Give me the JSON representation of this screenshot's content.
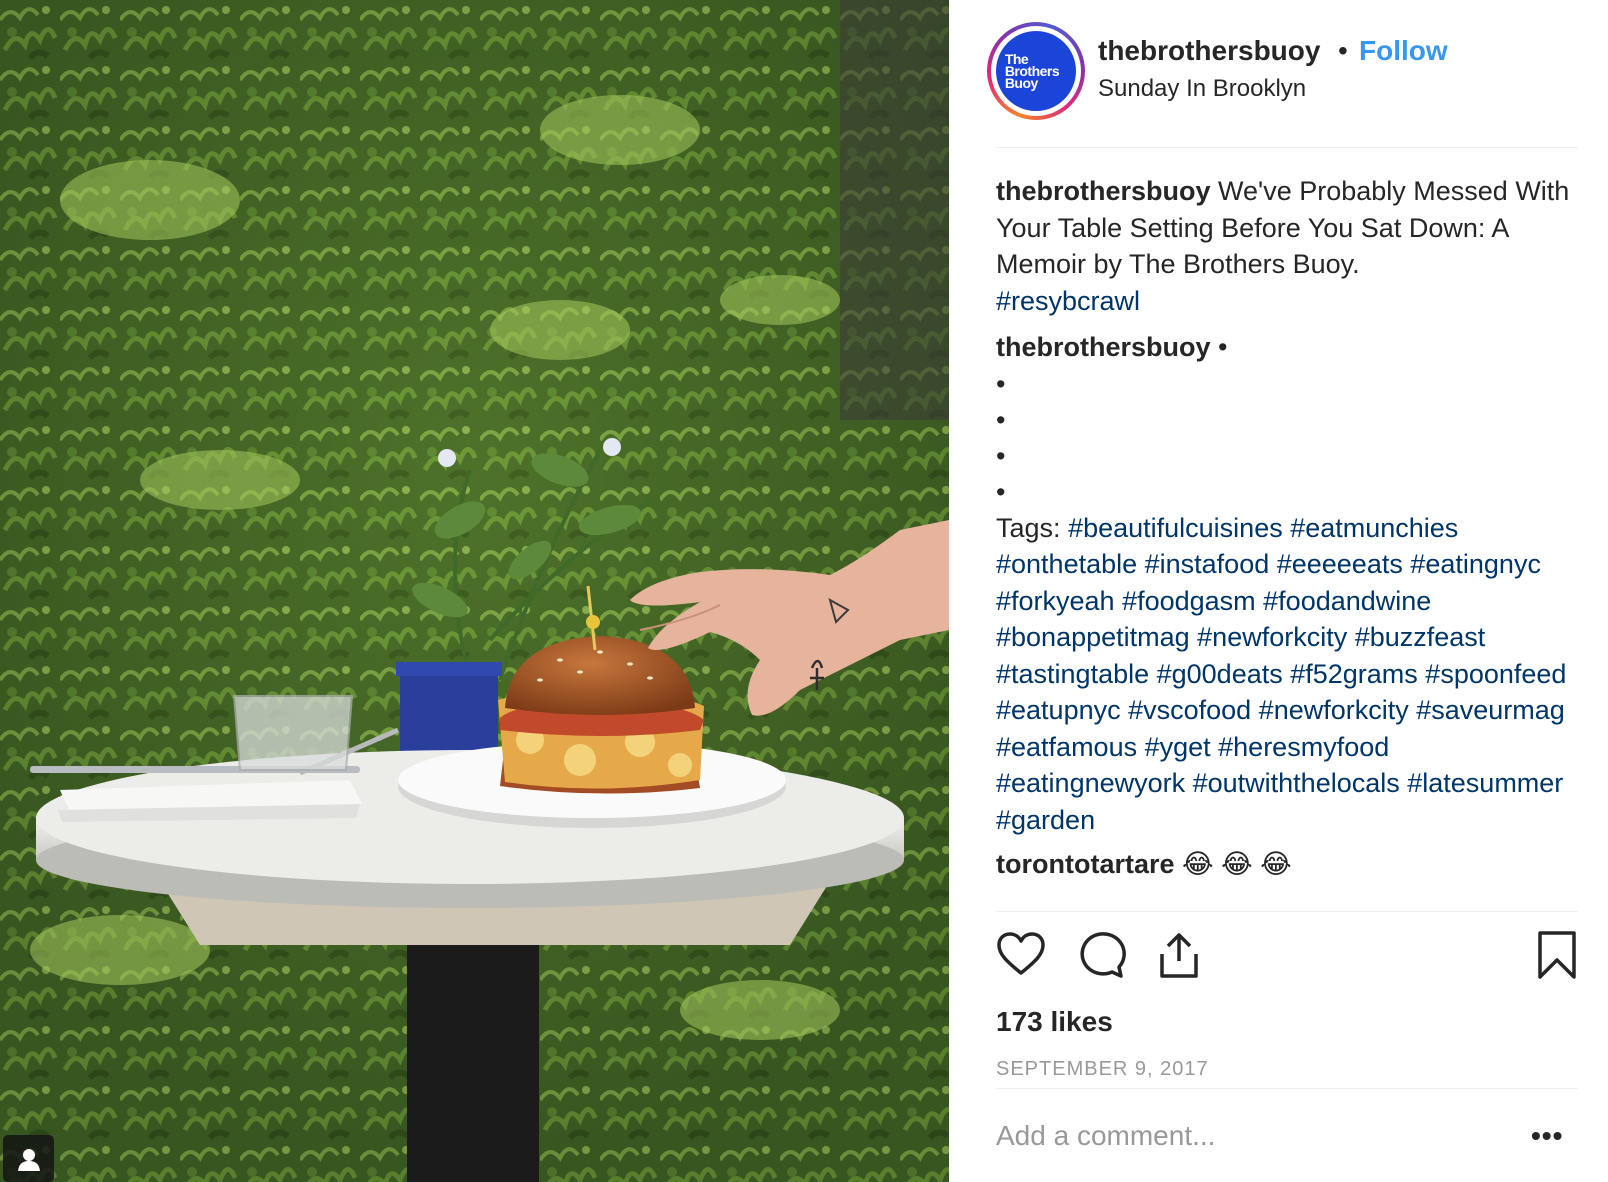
{
  "post": {
    "photo_alt": "",
    "header": {
      "avatar_text": "The\nBrothers\nBuoy",
      "username": "thebrothersbuoy",
      "separator": "•",
      "follow_label": "Follow",
      "location": "Sunday In Brooklyn"
    },
    "caption": {
      "user": "thebrothersbuoy",
      "text": "We've Probably Messed With Your Table Setting Before You Sat Down: A Memoir by The Brothers Buoy.",
      "hashtag": "#resybcrawl"
    },
    "comment_2": {
      "user": "thebrothersbuoy",
      "text": "•",
      "bullets": [
        "•",
        "•",
        "•",
        "•"
      ],
      "tags_label": "Tags:",
      "tags": "#beautifulcuisines #eatmunchies #onthetable #instafood #eeeeeats #eatingnyc #forkyeah #foodgasm #foodandwine #bonappetitmag #newforkcity #buzzfeast #tastingtable #g00deats #f52grams #spoonfeed #eatupnyc #vscofood #newforkcity #saveurmag #eatfamous #yget #heresmyfood #eatingnewyork #outwiththelocals #latesummer #garden"
    },
    "comment_3": {
      "user": "torontotartare",
      "text": "😂 😂 😂"
    },
    "actions": {
      "like_icon": "heart-icon",
      "comment_icon": "comment-bubble-icon",
      "share_icon": "share-icon",
      "save_icon": "bookmark-icon"
    },
    "likes": "173 likes",
    "date": "SEPTEMBER 9, 2017",
    "add_comment_placeholder": "Add a comment...",
    "more_label": "•••",
    "colors": {
      "accent": "#3897f0",
      "hashtag": "#003569",
      "avatar_bg": "#1b44d9"
    }
  }
}
